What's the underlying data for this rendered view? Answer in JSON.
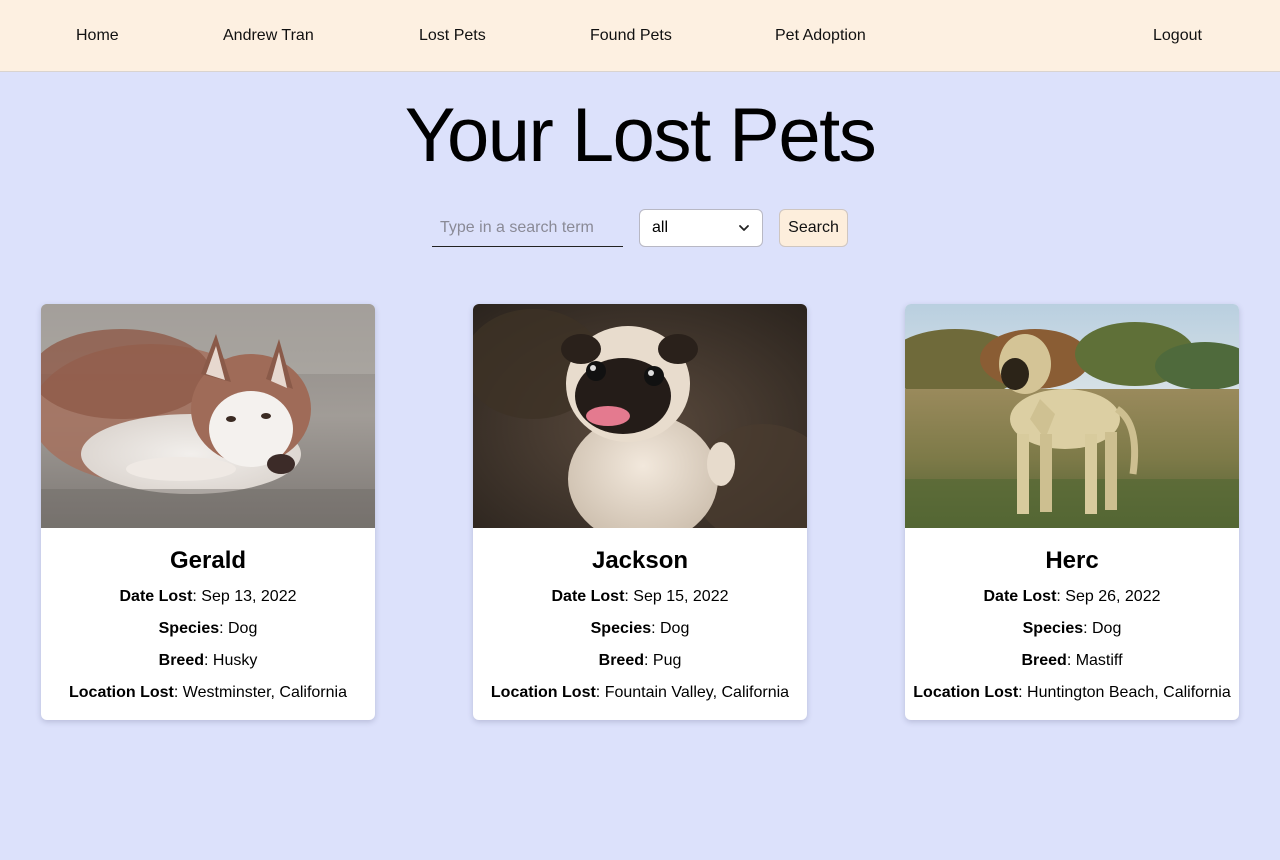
{
  "nav": {
    "home": "Home",
    "user": "Andrew Tran",
    "lost_pets": "Lost Pets",
    "found_pets": "Found Pets",
    "pet_adoption": "Pet Adoption",
    "logout": "Logout"
  },
  "page": {
    "title": "Your Lost Pets"
  },
  "search": {
    "placeholder": "Type in a search term",
    "value": "",
    "filter_selected": "all",
    "button_label": "Search"
  },
  "field_labels": {
    "date_lost": "Date Lost",
    "species": "Species",
    "breed": "Breed",
    "location_lost": "Location Lost",
    "separator": ": "
  },
  "pets": [
    {
      "name": "Gerald",
      "date_lost": "Sep 13, 2022",
      "species": "Dog",
      "breed": "Husky",
      "location_lost": "Westminster, California",
      "photo": "husky-lying-on-sand-photo"
    },
    {
      "name": "Jackson",
      "date_lost": "Sep 15, 2022",
      "species": "Dog",
      "breed": "Pug",
      "location_lost": "Fountain Valley, California",
      "photo": "pug-looking-up-photo"
    },
    {
      "name": "Herc",
      "date_lost": "Sep 26, 2022",
      "species": "Dog",
      "breed": "Mastiff",
      "location_lost": "Huntington Beach, California",
      "photo": "mastiff-standing-in-field-photo"
    }
  ],
  "colors": {
    "page_background": "#dce1fb",
    "navbar_background": "#fdf0e1",
    "search_button_background": "#fdeedc",
    "card_background": "#ffffff"
  }
}
